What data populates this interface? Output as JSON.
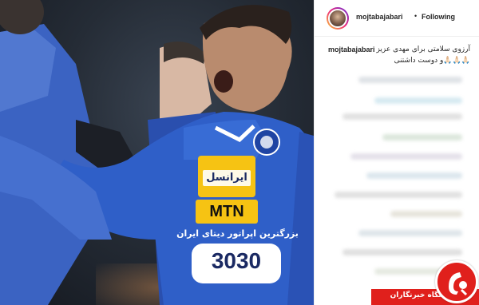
{
  "post": {
    "photo": {
      "jersey_sponsor_top": "ایرانسل",
      "jersey_sponsor_brand": "MTN",
      "jersey_text": "بزرگترین اپراتور دیتای ایران",
      "jersey_number_block": "3030"
    }
  },
  "header": {
    "username": "mojtabajabari",
    "separator": "•",
    "follow_label": "Following"
  },
  "caption": {
    "username": "mojtabajabari",
    "line1": "آرزوی سلامتی برای مهدی عزیز",
    "line2": "🙏🏻🙏🏻🙏🏻و دوست داشتنی"
  },
  "watermark": {
    "label": "باشگاه خبرنگاران"
  },
  "colors": {
    "jersey_blue": "#2f5fc8",
    "watermark_red": "#e0201c",
    "instagram_text": "#262626"
  }
}
